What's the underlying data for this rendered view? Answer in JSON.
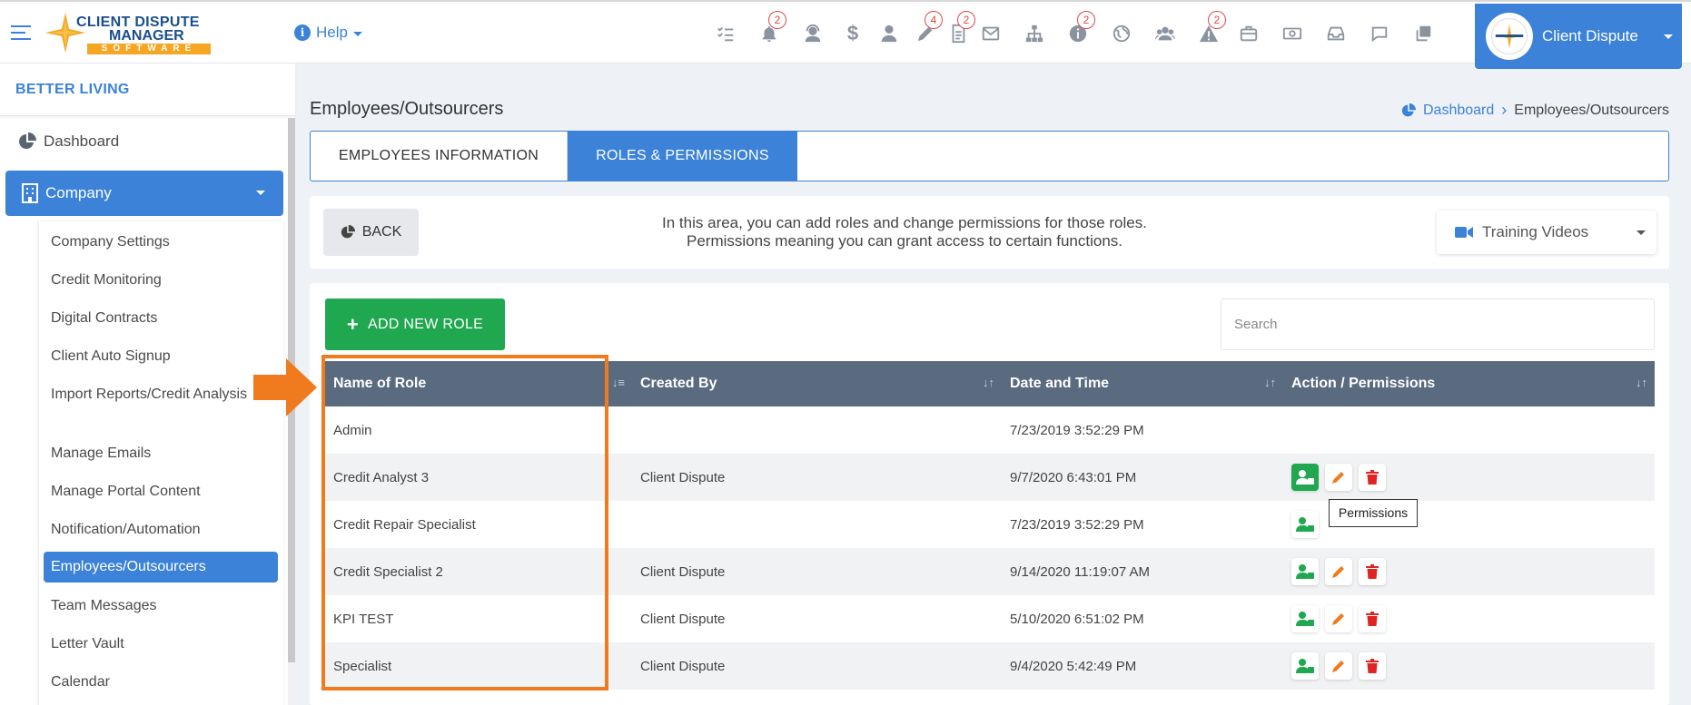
{
  "app": {
    "logo": {
      "line1": "CLIENT DISPUTE",
      "line2": "MANAGER",
      "line3": "SOFTWARE"
    },
    "help_label": "Help",
    "user_name": "Client Dispute"
  },
  "toolbar_icons": [
    {
      "name": "tasks-icon",
      "badge": ""
    },
    {
      "name": "bell-icon",
      "badge": "2"
    },
    {
      "name": "support-agent-icon",
      "badge": ""
    },
    {
      "name": "dollar-icon",
      "badge": ""
    },
    {
      "name": "user-icon",
      "badge": ""
    },
    {
      "name": "pen-icon",
      "badge": "4"
    },
    {
      "name": "document-icon",
      "badge": "2"
    },
    {
      "name": "mail-icon",
      "badge": ""
    },
    {
      "name": "sitemap-icon",
      "badge": ""
    },
    {
      "name": "info-icon",
      "badge": "2"
    },
    {
      "name": "globe-icon",
      "badge": ""
    },
    {
      "name": "users-icon",
      "badge": ""
    },
    {
      "name": "warning-icon",
      "badge": "2"
    },
    {
      "name": "briefcase-icon",
      "badge": ""
    },
    {
      "name": "money-icon",
      "badge": ""
    },
    {
      "name": "inbox-icon",
      "badge": ""
    },
    {
      "name": "chat-icon",
      "badge": ""
    },
    {
      "name": "copy-icon",
      "badge": ""
    }
  ],
  "sidebar": {
    "org_name": "BETTER LIVING",
    "dashboard": "Dashboard",
    "company": "Company",
    "submenu": [
      "Company Settings",
      "Credit Monitoring",
      "Digital Contracts",
      "Client Auto Signup",
      "Import Reports/Credit Analysis",
      "Manage Emails",
      "Manage Portal Content",
      "Notification/Automation",
      "Employees/Outsourcers",
      "Team Messages",
      "Letter Vault",
      "Calendar"
    ]
  },
  "page": {
    "title": "Employees/Outsourcers",
    "breadcrumb": {
      "home": "Dashboard",
      "current": "Employees/Outsourcers"
    },
    "tabs": [
      "EMPLOYEES INFORMATION",
      "ROLES & PERMISSIONS"
    ],
    "back_label": "BACK",
    "info_line1": "In this area, you can add roles and change permissions for those roles.",
    "info_line2": "Permissions meaning you can grant access to certain functions.",
    "training_label": "Training Videos",
    "add_role_label": "ADD NEW ROLE",
    "search_placeholder": "Search",
    "tooltip": "Permissions"
  },
  "table": {
    "headers": [
      "Name of Role",
      "Created By",
      "Date and Time",
      "Action / Permissions"
    ],
    "rows": [
      {
        "name": "Admin",
        "created_by": "",
        "date": "7/23/2019 3:52:29 PM",
        "actions": "none"
      },
      {
        "name": "Credit Analyst 3",
        "created_by": "Client Dispute",
        "date": "9/7/2020 6:43:01 PM",
        "actions": "all-active"
      },
      {
        "name": "Credit Repair Specialist",
        "created_by": "",
        "date": "7/23/2019 3:52:29 PM",
        "actions": "perm-only"
      },
      {
        "name": "Credit Specialist 2",
        "created_by": "Client Dispute",
        "date": "9/14/2020 11:19:07 AM",
        "actions": "all"
      },
      {
        "name": "KPI TEST",
        "created_by": "Client Dispute",
        "date": "5/10/2020 6:51:02 PM",
        "actions": "all"
      },
      {
        "name": "Specialist",
        "created_by": "Client Dispute",
        "date": "9/4/2020 5:42:49 PM",
        "actions": "all"
      }
    ]
  },
  "colors": {
    "primary": "#3b82d8",
    "success": "#1fa84f",
    "danger": "#e02424",
    "edit": "#f07a1e",
    "header": "#5a6b80",
    "highlight": "#f07a1e"
  }
}
